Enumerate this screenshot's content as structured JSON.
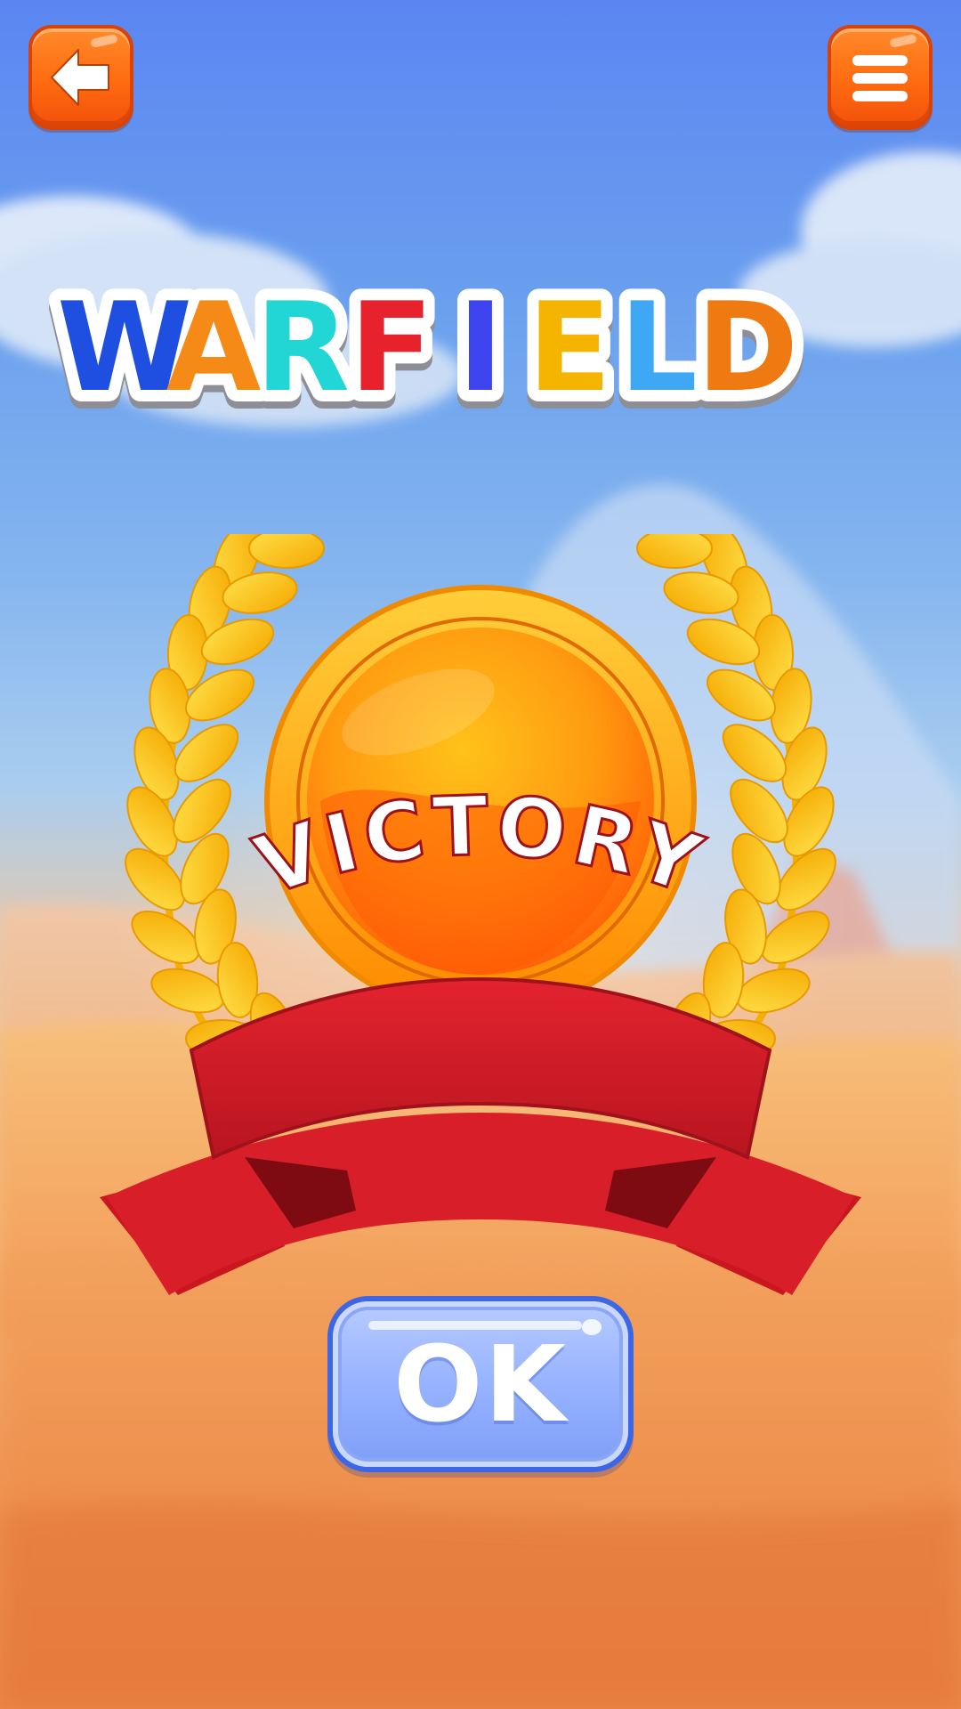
{
  "game": {
    "title": "WARFIELD",
    "title_letters": [
      {
        "char": "W",
        "color": "#1f4fe0"
      },
      {
        "char": "A",
        "color": "#f58a16"
      },
      {
        "char": "R",
        "color": "#22d6d6"
      },
      {
        "char": "F",
        "color": "#e8222c"
      },
      {
        "char": "I",
        "color": "#3e45f0"
      },
      {
        "char": "E",
        "color": "#f4b400"
      },
      {
        "char": "L",
        "color": "#3fa8f5"
      },
      {
        "char": "D",
        "color": "#ef7a12"
      }
    ]
  },
  "header": {
    "back_icon": "arrow-left-icon",
    "menu_icon": "hamburger-menu-icon"
  },
  "result": {
    "banner_text": "VICTORY",
    "medal_icon": "gold-medal-icon",
    "laurel_icon": "laurel-wreath-icon"
  },
  "actions": {
    "ok_label": "OK"
  },
  "colors": {
    "button_orange": "#ff6b10",
    "button_blue": "#7d9ef8",
    "ribbon_red": "#d41f2a",
    "medal_gold": "#ffb000"
  }
}
